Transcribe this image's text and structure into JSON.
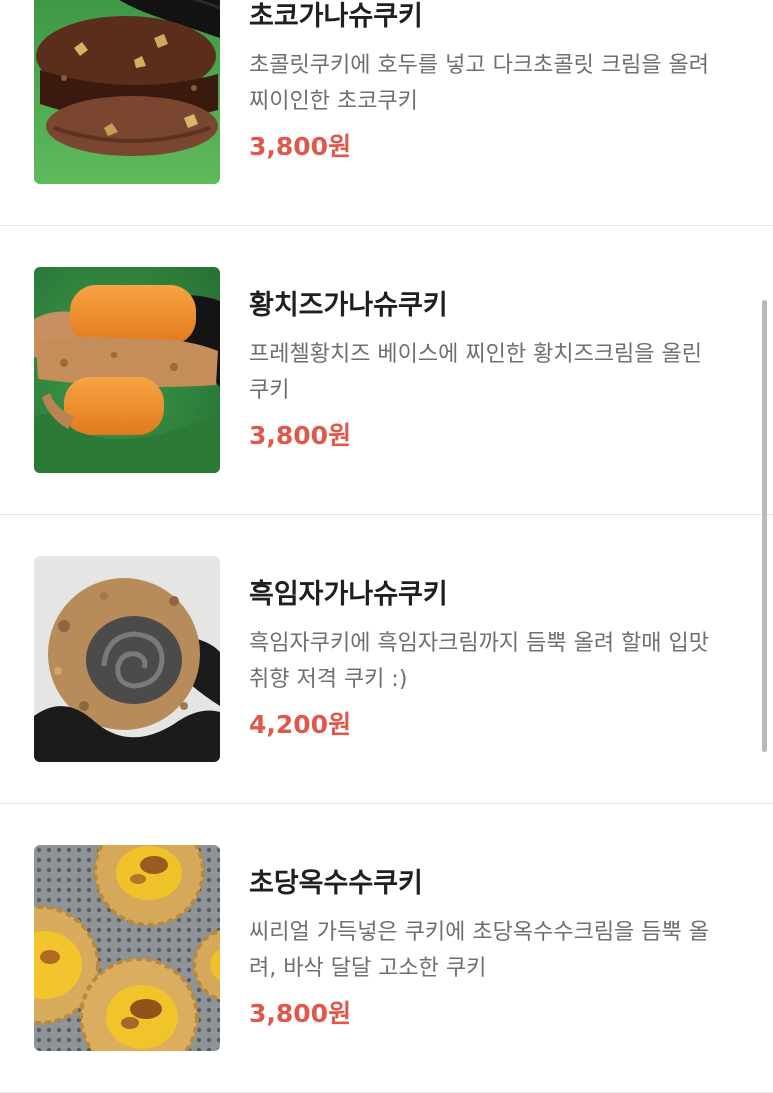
{
  "colors": {
    "price": "#e0584b",
    "title": "#1f1f1f",
    "description": "#6f6f6f",
    "divider": "#e6e6e6",
    "scrollbar": "#b9b9b9"
  },
  "items": [
    {
      "name": "초코가나슈쿠키",
      "description": [
        "초콜릿쿠키에 호두를 넣고 다크초콜릿 크림을 올려",
        "찌이인한 초코쿠키"
      ],
      "price": "3,800원"
    },
    {
      "name": "황치즈가나슈쿠키",
      "description": [
        "프레첼황치즈 베이스에 찌인한 황치즈크림을 올린",
        "쿠키"
      ],
      "price": "3,800원"
    },
    {
      "name": "흑임자가나슈쿠키",
      "description": [
        "흑임자쿠키에 흑임자크림까지 듬뿍 올려 할매 입맛",
        "취향 저격 쿠키 :)"
      ],
      "price": "4,200원"
    },
    {
      "name": "초당옥수수쿠키",
      "description": [
        "씨리얼 가득넣은 쿠키에 초당옥수수크림을 듬뿍 올",
        "려, 바삭 달달 고소한 쿠키"
      ],
      "price": "3,800원"
    }
  ]
}
